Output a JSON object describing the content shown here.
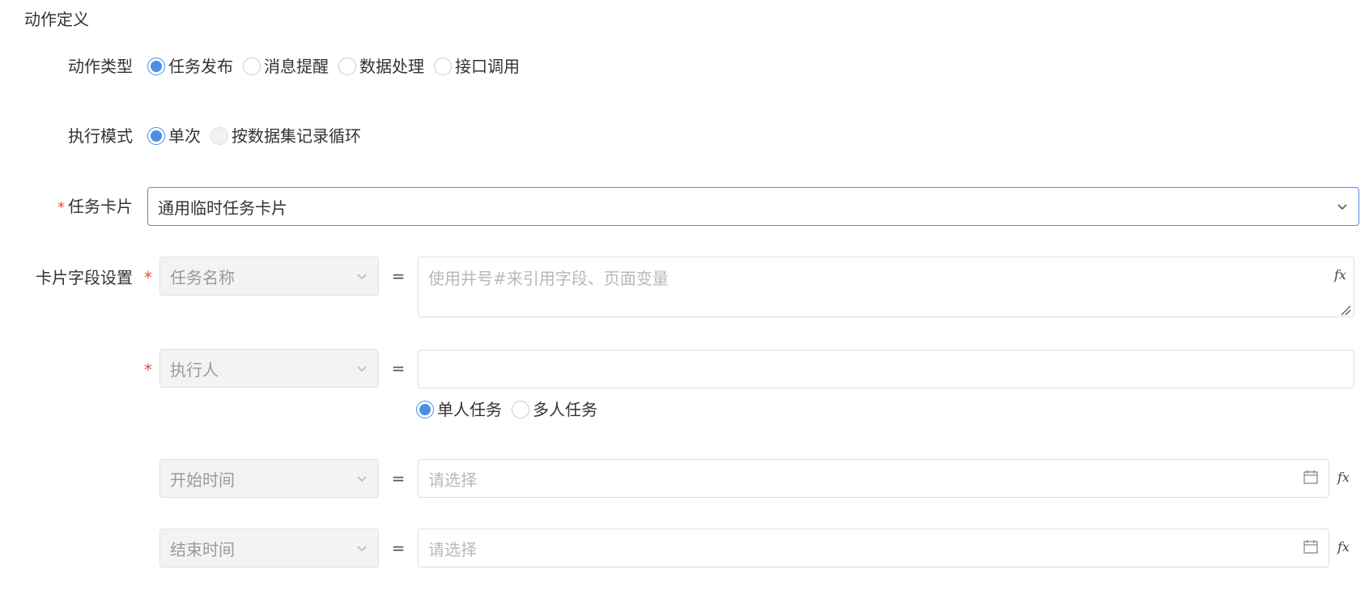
{
  "section_title": "动作定义",
  "action_type": {
    "label": "动作类型",
    "options": [
      "任务发布",
      "消息提醒",
      "数据处理",
      "接口调用"
    ],
    "selected": "任务发布"
  },
  "exec_mode": {
    "label": "执行模式",
    "options": [
      "单次",
      "按数据集记录循环"
    ],
    "selected": "单次"
  },
  "task_card": {
    "required_mark": "*",
    "label": "任务卡片",
    "value": "通用临时任务卡片"
  },
  "card_fields": {
    "label": "卡片字段设置",
    "equals": "=",
    "fx": "fx",
    "rows": [
      {
        "required": true,
        "field": "任务名称",
        "placeholder": "使用井号#来引用字段、页面变量"
      },
      {
        "required": true,
        "field": "执行人",
        "placeholder": "",
        "assign_options": [
          "单人任务",
          "多人任务"
        ],
        "assign_selected": "单人任务"
      },
      {
        "required": false,
        "field": "开始时间",
        "placeholder": "请选择"
      },
      {
        "required": false,
        "field": "结束时间",
        "placeholder": "请选择"
      }
    ]
  },
  "colors": {
    "accent": "#4a90e2",
    "required": "#f04a3e"
  }
}
